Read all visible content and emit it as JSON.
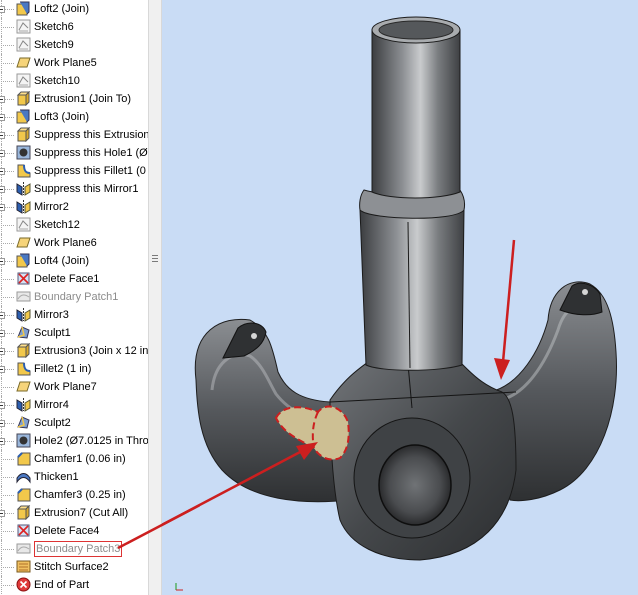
{
  "browser": {
    "items": [
      {
        "label": "Loft2 (Join)",
        "icon": "loft-icon",
        "expand": true
      },
      {
        "label": "Sketch6",
        "icon": "sketch-icon",
        "expand": false
      },
      {
        "label": "Sketch9",
        "icon": "sketch-icon",
        "expand": false
      },
      {
        "label": "Work Plane5",
        "icon": "work-plane-icon",
        "expand": false
      },
      {
        "label": "Sketch10",
        "icon": "sketch-icon",
        "expand": false
      },
      {
        "label": "Extrusion1 (Join To)",
        "icon": "extrusion-icon",
        "expand": true
      },
      {
        "label": "Loft3 (Join)",
        "icon": "loft-icon",
        "expand": true
      },
      {
        "label": "Suppress this Extrusion",
        "icon": "extrusion-icon",
        "expand": true
      },
      {
        "label": "Suppress this Hole1 (Ø",
        "icon": "hole-icon",
        "expand": true
      },
      {
        "label": "Suppress this Fillet1 (0",
        "icon": "fillet-icon",
        "expand": true
      },
      {
        "label": "Suppress this Mirror1",
        "icon": "mirror-icon",
        "expand": true
      },
      {
        "label": "Mirror2",
        "icon": "mirror-icon",
        "expand": true
      },
      {
        "label": "Sketch12",
        "icon": "sketch-icon",
        "expand": false
      },
      {
        "label": "Work Plane6",
        "icon": "work-plane-icon",
        "expand": false
      },
      {
        "label": "Loft4 (Join)",
        "icon": "loft-icon",
        "expand": true
      },
      {
        "label": "Delete Face1",
        "icon": "delete-face-icon",
        "expand": false
      },
      {
        "label": "Boundary Patch1",
        "icon": "boundary-patch-icon",
        "expand": false,
        "dim": true
      },
      {
        "label": "Mirror3",
        "icon": "mirror-icon",
        "expand": true
      },
      {
        "label": "Sculpt1",
        "icon": "sculpt-icon",
        "expand": true
      },
      {
        "label": "Extrusion3 (Join x 12 in",
        "icon": "extrusion-icon",
        "expand": true
      },
      {
        "label": "Fillet2 (1 in)",
        "icon": "fillet-icon",
        "expand": true
      },
      {
        "label": "Work Plane7",
        "icon": "work-plane-icon",
        "expand": false
      },
      {
        "label": "Mirror4",
        "icon": "mirror-icon",
        "expand": true
      },
      {
        "label": "Sculpt2",
        "icon": "sculpt-icon",
        "expand": true
      },
      {
        "label": "Hole2 (Ø7.0125 in Thro",
        "icon": "hole-icon",
        "expand": true
      },
      {
        "label": "Chamfer1 (0.06 in)",
        "icon": "chamfer-icon",
        "expand": false
      },
      {
        "label": "Thicken1",
        "icon": "thicken-icon",
        "expand": false
      },
      {
        "label": "Chamfer3 (0.25 in)",
        "icon": "chamfer-icon",
        "expand": false
      },
      {
        "label": "Extrusion7 (Cut All)",
        "icon": "extrusion-icon",
        "expand": true
      },
      {
        "label": "Delete Face4",
        "icon": "delete-face-icon",
        "expand": false
      },
      {
        "label": "Boundary Patch3",
        "icon": "boundary-patch-icon",
        "expand": false,
        "dim": true,
        "highlighted": true
      },
      {
        "label": "Stitch Surface2",
        "icon": "stitch-icon",
        "expand": false
      },
      {
        "label": "End of Part",
        "icon": "end-of-part-icon",
        "expand": false
      }
    ]
  },
  "colors": {
    "viewport_background": "#c9dcf5",
    "annotation_red": "#cc1f1f",
    "model_steel": "#5a5d60",
    "patch_tan": "#cdbf93",
    "tree_item_dim": "#8c8c8c"
  }
}
